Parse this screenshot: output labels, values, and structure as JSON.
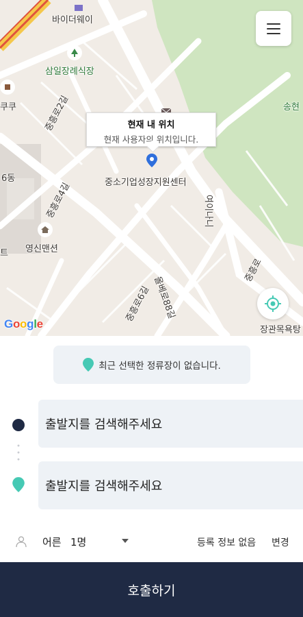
{
  "map": {
    "labels": {
      "bidaway": "바이더웨이",
      "samil_funeral": "삼일장례식장",
      "kuku": "쿠쿠",
      "songhyeon": "송현",
      "six_dong": "6동",
      "young_shin": "영신맨션",
      "bangkok_t": "트",
      "jangwan": "장관목욕탕",
      "jungso": "중소기업성장지원센터",
      "road_jungheung2": "중흥로2길",
      "road_jungheung4": "중흥로4길",
      "road_jungheung6": "중흥로6길",
      "road_jungheung": "중흥로",
      "road_olbae": "올베로88길",
      "road_vertical": "여이나니"
    },
    "tooltip": {
      "title": "현재 내 위치",
      "subtitle": "현재 사용자의 위치입니다."
    },
    "google": [
      "G",
      "o",
      "o",
      "g",
      "l",
      "e"
    ],
    "google_colors": [
      "#4285F4",
      "#EA4335",
      "#FBBC05",
      "#4285F4",
      "#34A853",
      "#EA4335"
    ]
  },
  "menu": {
    "icon": "hamburger-icon"
  },
  "panel": {
    "notice": "최근 선택한 정류장이 없습니다.",
    "start_field": "출발지를 검색해주세요",
    "end_field": "출발지를 검색해주세요",
    "options": {
      "passenger_type": "어른",
      "passenger_count": "1명",
      "registration": "등록 정보 없음",
      "change": "변경"
    },
    "call_button": "호출하기"
  },
  "colors": {
    "navy": "#1f2a44",
    "teal": "#46c9b4",
    "field_bg": "#eef2f6"
  }
}
